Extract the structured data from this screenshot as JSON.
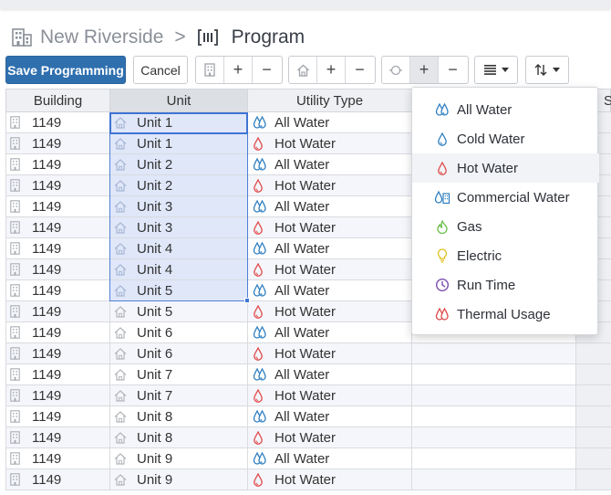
{
  "breadcrumb": {
    "parent": "New Riverside",
    "separator": ">",
    "current": "Program"
  },
  "toolbar": {
    "save_label": "Save Programming",
    "cancel_label": "Cancel",
    "plus": "+",
    "minus": "−"
  },
  "columns": {
    "building": "Building",
    "unit": "Unit",
    "utility_type": "Utility Type",
    "partial_next": "S"
  },
  "rows": [
    {
      "building": "1149",
      "unit": "Unit 1",
      "utility": "All Water",
      "icon": "all-water"
    },
    {
      "building": "1149",
      "unit": "Unit 1",
      "utility": "Hot Water",
      "icon": "hot-water"
    },
    {
      "building": "1149",
      "unit": "Unit 2",
      "utility": "All Water",
      "icon": "all-water"
    },
    {
      "building": "1149",
      "unit": "Unit 2",
      "utility": "Hot Water",
      "icon": "hot-water"
    },
    {
      "building": "1149",
      "unit": "Unit 3",
      "utility": "All Water",
      "icon": "all-water"
    },
    {
      "building": "1149",
      "unit": "Unit 3",
      "utility": "Hot Water",
      "icon": "hot-water"
    },
    {
      "building": "1149",
      "unit": "Unit 4",
      "utility": "All Water",
      "icon": "all-water"
    },
    {
      "building": "1149",
      "unit": "Unit 4",
      "utility": "Hot Water",
      "icon": "hot-water"
    },
    {
      "building": "1149",
      "unit": "Unit 5",
      "utility": "All Water",
      "icon": "all-water"
    },
    {
      "building": "1149",
      "unit": "Unit 5",
      "utility": "Hot Water",
      "icon": "hot-water"
    },
    {
      "building": "1149",
      "unit": "Unit 6",
      "utility": "All Water",
      "icon": "all-water"
    },
    {
      "building": "1149",
      "unit": "Unit 6",
      "utility": "Hot Water",
      "icon": "hot-water"
    },
    {
      "building": "1149",
      "unit": "Unit 7",
      "utility": "All Water",
      "icon": "all-water"
    },
    {
      "building": "1149",
      "unit": "Unit 7",
      "utility": "Hot Water",
      "icon": "hot-water"
    },
    {
      "building": "1149",
      "unit": "Unit 8",
      "utility": "All Water",
      "icon": "all-water"
    },
    {
      "building": "1149",
      "unit": "Unit 8",
      "utility": "Hot Water",
      "icon": "hot-water"
    },
    {
      "building": "1149",
      "unit": "Unit 9",
      "utility": "All Water",
      "icon": "all-water"
    },
    {
      "building": "1149",
      "unit": "Unit 9",
      "utility": "Hot Water",
      "icon": "hot-water"
    }
  ],
  "utility_menu": [
    {
      "label": "All Water",
      "icon": "all-water-icon",
      "color": "#2f7fc1"
    },
    {
      "label": "Cold Water",
      "icon": "cold-water-icon",
      "color": "#2f7fc1"
    },
    {
      "label": "Hot Water",
      "icon": "hot-water-icon",
      "color": "#e04848"
    },
    {
      "label": "Commercial Water",
      "icon": "commercial-water-icon",
      "color": "#2f7fc1"
    },
    {
      "label": "Gas",
      "icon": "gas-icon",
      "color": "#6cbf4a"
    },
    {
      "label": "Electric",
      "icon": "electric-icon",
      "color": "#e0c020"
    },
    {
      "label": "Run Time",
      "icon": "run-time-icon",
      "color": "#7b4fb0"
    },
    {
      "label": "Thermal Usage",
      "icon": "thermal-usage-icon",
      "color": "#e04848"
    }
  ],
  "colors": {
    "primary": "#2f6fae",
    "selection": "#dfe7f9",
    "water_blue": "#2f7fc1",
    "hot_red": "#e04848"
  }
}
